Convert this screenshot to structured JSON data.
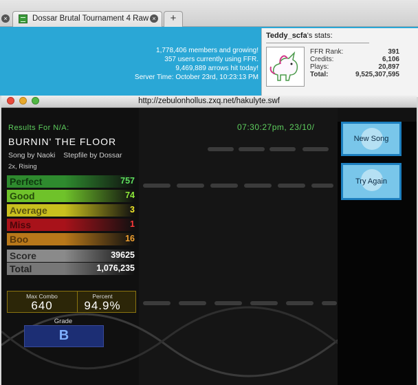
{
  "browser": {
    "tab_title": "Dossar Brutal Tournament 4 Raw",
    "close_glyph": "×",
    "new_tab_glyph": "+"
  },
  "site": {
    "stats_lines": [
      "1,778,406 members and growing!",
      "357 users currently using FFR.",
      "9,469,889 arrows hit today!",
      "Server Time: October 23rd, 10:23:13 PM"
    ],
    "user": {
      "name": "Teddy_scfa",
      "name_suffix": "'s stats:",
      "avatar_icon": "unicorn-avatar",
      "stats": [
        {
          "label": "FFR Rank:",
          "value": "391"
        },
        {
          "label": "Credits:",
          "value": "6,106"
        },
        {
          "label": "Plays:",
          "value": "20,897"
        },
        {
          "label": "Total:",
          "value": "9,525,307,595"
        }
      ]
    }
  },
  "popup": {
    "url": "http://zebulonhollus.zxq.net/hakulyte.swf"
  },
  "results": {
    "header": "Results For N/A:",
    "timestamp": "07:30:27pm, 23/10/",
    "song_title": "BURNIN' THE FLOOR",
    "song_by": "Song by Naoki",
    "stepfile_by": "Stepfile by Dossar",
    "mods": "2x, Rising",
    "judgements": [
      {
        "label": "Perfect",
        "value": "757",
        "color": "#2e8a2e",
        "text": "#0f3a0f",
        "num": "#5ee05e"
      },
      {
        "label": "Good",
        "value": "74",
        "color": "#6fc22a",
        "text": "#244a0a",
        "num": "#8eea3a"
      },
      {
        "label": "Average",
        "value": "3",
        "color": "#c9c01e",
        "text": "#5a5410",
        "num": "#f2ea2a"
      },
      {
        "label": "Miss",
        "value": "1",
        "color": "#a8121a",
        "text": "#4a060a",
        "num": "#ff3a3a"
      },
      {
        "label": "Boo",
        "value": "16",
        "color": "#b8781a",
        "text": "#5a380a",
        "num": "#f0a030"
      },
      {
        "label": "Score",
        "value": "39625",
        "color": "#8a8a8a",
        "text": "#2a2a2a",
        "num": "#ffffff"
      },
      {
        "label": "Total",
        "value": "1,076,235",
        "color": "#777777",
        "text": "#222222",
        "num": "#ffffff"
      }
    ],
    "max_combo_label": "Max Combo",
    "max_combo": "640",
    "percent_label": "Percent",
    "percent": "94.9%",
    "grade_label": "Grade",
    "grade": "B"
  },
  "menu": {
    "new_song": "New Song",
    "try_again": "Try Again"
  }
}
